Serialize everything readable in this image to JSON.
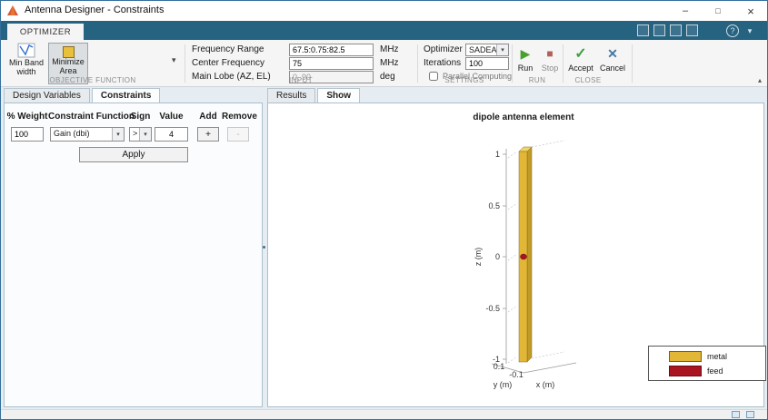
{
  "window": {
    "title": "Antenna Designer - Constraints"
  },
  "icons": {
    "minimize": "–",
    "maximize": "□",
    "close": "×",
    "help": "?",
    "collapse_ribbon": "▾",
    "collapse_toolstrip": "▴",
    "objective_dropdown": "▾",
    "select_arrow": "▾",
    "run": "▶",
    "stop": "■",
    "accept": "✓",
    "cancel": "✕"
  },
  "ribbon": {
    "tab": "OPTIMIZER",
    "objective": {
      "section": "OBJECTIVE FUNCTION",
      "min_bandwidth": "Min Bandwidth",
      "minimize_area": "Minimize Area"
    },
    "input": {
      "section": "INPUT",
      "rows": [
        {
          "label": "Frequency Range",
          "value": "67.5:0.75:82.5",
          "unit": "MHz"
        },
        {
          "label": "Center Frequency",
          "value": "75",
          "unit": "MHz"
        },
        {
          "label": "Main Lobe (AZ, EL)",
          "value": "0, 90",
          "unit": "deg"
        }
      ]
    },
    "settings": {
      "section": "SETTINGS",
      "optimizer_label": "Optimizer",
      "optimizer_value": "SADEA",
      "iterations_label": "Iterations",
      "iterations_value": "100",
      "parallel_label": "Parallel Computing"
    },
    "run": {
      "section": "RUN",
      "run_label": "Run",
      "stop_label": "Stop"
    },
    "close": {
      "section": "CLOSE",
      "accept_label": "Accept",
      "cancel_label": "Cancel"
    }
  },
  "left_panel": {
    "tabs": [
      {
        "label": "Design Variables"
      },
      {
        "label": "Constraints"
      }
    ],
    "active_tab": "Constraints",
    "headers": [
      "% Weight",
      "Constraint Function",
      "Sign",
      "Value",
      "Add",
      "Remove"
    ],
    "row": {
      "weight": "100",
      "function": "Gain (dbi)",
      "sign": ">",
      "value": "4",
      "add": "+",
      "remove": "-"
    },
    "apply_label": "Apply"
  },
  "right_panel": {
    "tabs": [
      {
        "label": "Results"
      },
      {
        "label": "Show"
      }
    ],
    "active_tab": "Show"
  },
  "chart_data": {
    "type": "3d-geometry",
    "title": "dipole antenna element",
    "xlabel": "x (m)",
    "ylabel": "y (m)",
    "zlabel": "z (m)",
    "z_ticks": [
      "1",
      "0.5",
      "0",
      "-0.5",
      "-1"
    ],
    "x_ticks": [
      "-0.1"
    ],
    "y_ticks": [
      "0.1"
    ],
    "zlim": [
      -1,
      1
    ],
    "geometry": {
      "element": "dipole",
      "metal_color": "#e2b636",
      "feed_color": "#a81420",
      "feed_z": 0,
      "length_m": 2
    },
    "legend": [
      {
        "label": "metal",
        "color": "#e2b636"
      },
      {
        "label": "feed",
        "color": "#a81420"
      }
    ]
  }
}
